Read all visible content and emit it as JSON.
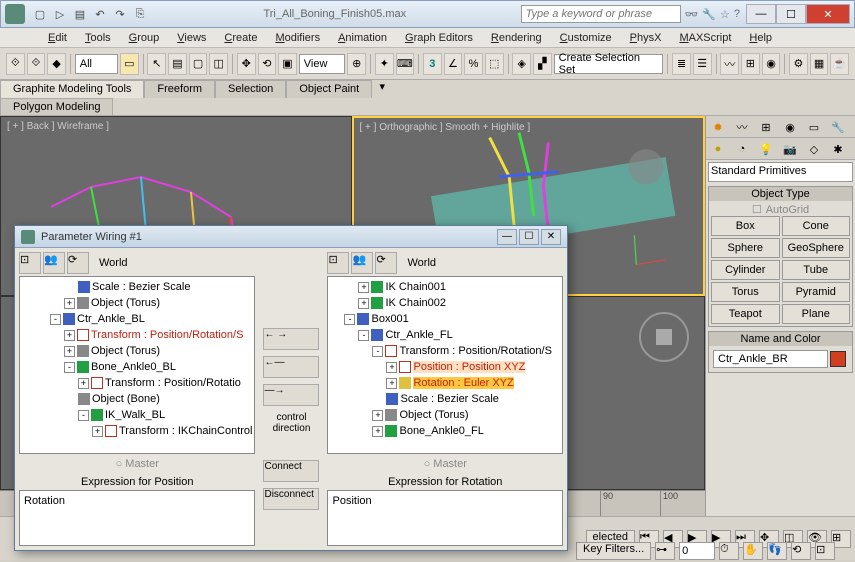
{
  "window": {
    "title": "Tri_All_Boning_Finish05.max",
    "search_placeholder": "Type a keyword or phrase"
  },
  "menu": {
    "items": [
      "Edit",
      "Tools",
      "Group",
      "Views",
      "Create",
      "Modifiers",
      "Animation",
      "Graph Editors",
      "Rendering",
      "Customize",
      "PhysX",
      "MAXScript",
      "Help"
    ]
  },
  "toolbar": {
    "all": "All",
    "view": "View",
    "num": "3",
    "selset": "Create Selection Set"
  },
  "ribbon": {
    "tabs": [
      "Graphite Modeling Tools",
      "Freeform",
      "Selection",
      "Object Paint"
    ],
    "sub": "Polygon Modeling"
  },
  "viewports": {
    "v0": "[ + ] Back ] Wireframe ]",
    "v1": "[ + ] Orthographic ] Smooth + Highlite ]"
  },
  "timeline": {
    "t0": "90",
    "t1": "100"
  },
  "rpanel": {
    "category": "Standard Primitives",
    "objtype": "Object Type",
    "autogrid": "AutoGrid",
    "prims": [
      "Box",
      "Cone",
      "Sphere",
      "GeoSphere",
      "Cylinder",
      "Tube",
      "Torus",
      "Pyramid",
      "Teapot",
      "Plane"
    ],
    "namecolor": "Name and Color",
    "objname": "Ctr_Ankle_BR"
  },
  "status": {
    "selected": "elected",
    "keyfilters": "Key Filters...",
    "frame": "0"
  },
  "dialog": {
    "title": "Parameter Wiring #1",
    "world": "World",
    "left_tree": [
      {
        "ind": 4,
        "exp": "",
        "icon": "ti-blue",
        "text": "Scale : Bezier Scale"
      },
      {
        "ind": 3,
        "exp": "+",
        "icon": "ti-gray",
        "text": "Object (Torus)"
      },
      {
        "ind": 2,
        "exp": "-",
        "icon": "ti-blue",
        "text": "Ctr_Ankle_BL"
      },
      {
        "ind": 3,
        "exp": "+",
        "icon": "ti-red",
        "text": "Transform : Position/Rotation/S",
        "cls": "hl-red"
      },
      {
        "ind": 3,
        "exp": "+",
        "icon": "ti-gray",
        "text": "Object (Torus)"
      },
      {
        "ind": 3,
        "exp": "-",
        "icon": "ti-green",
        "text": "Bone_Ankle0_BL"
      },
      {
        "ind": 4,
        "exp": "+",
        "icon": "ti-red",
        "text": "Transform : Position/Rotatio"
      },
      {
        "ind": 4,
        "exp": "",
        "icon": "ti-gray",
        "text": "Object (Bone)"
      },
      {
        "ind": 4,
        "exp": "-",
        "icon": "ti-green",
        "text": "IK_Walk_BL"
      },
      {
        "ind": 5,
        "exp": "+",
        "icon": "ti-red",
        "text": "Transform : IKChainControl"
      }
    ],
    "right_tree": [
      {
        "ind": 2,
        "exp": "+",
        "icon": "ti-green",
        "text": "IK Chain001"
      },
      {
        "ind": 2,
        "exp": "+",
        "icon": "ti-green",
        "text": "IK Chain002"
      },
      {
        "ind": 1,
        "exp": "-",
        "icon": "ti-blue",
        "text": "Box001"
      },
      {
        "ind": 2,
        "exp": "-",
        "icon": "ti-blue",
        "text": "Ctr_Ankle_FL"
      },
      {
        "ind": 3,
        "exp": "-",
        "icon": "ti-red",
        "text": "Transform : Position/Rotation/S"
      },
      {
        "ind": 4,
        "exp": "+",
        "icon": "ti-red",
        "text": "Position : Position XYZ",
        "cls": "hl-pos"
      },
      {
        "ind": 4,
        "exp": "+",
        "icon": "ti-yel",
        "text": "Rotation : Euler XYZ",
        "cls": "hl-rot"
      },
      {
        "ind": 4,
        "exp": "",
        "icon": "ti-blue",
        "text": "Scale : Bezier Scale"
      },
      {
        "ind": 3,
        "exp": "+",
        "icon": "ti-gray",
        "text": "Object (Torus)"
      },
      {
        "ind": 3,
        "exp": "+",
        "icon": "ti-green",
        "text": "Bone_Ankle0_FL"
      }
    ],
    "control_direction": "control\ndirection",
    "connect": "Connect",
    "disconnect": "Disconnect",
    "master": "Master",
    "expr_left": "Expression for Position",
    "expr_right": "Expression for Rotation",
    "field_left": "Rotation",
    "field_right": "Position"
  }
}
